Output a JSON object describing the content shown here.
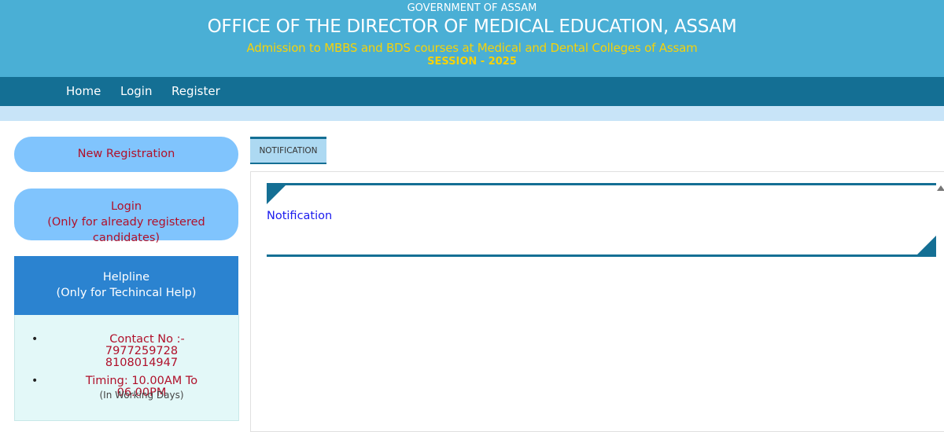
{
  "header": {
    "gov": "GOVERNMENT OF ASSAM",
    "office": "OFFICE OF THE DIRECTOR OF MEDICAL EDUCATION, ASSAM",
    "admission": "Admission to MBBS and BDS courses at Medical and Dental Colleges of Assam",
    "session": "SESSION - 2025"
  },
  "nav": {
    "home": "Home",
    "login": "Login",
    "register": "Register"
  },
  "sidebar": {
    "new_registration": "New Registration",
    "login_line1": "Login",
    "login_line2": "(Only for already registered candidates)",
    "helpline_title": "Helpline",
    "helpline_sub": "(Only for Techincal Help)",
    "contact_label": "Contact No :-",
    "phone1": "7977259728",
    "phone2": "8108014947",
    "timing": "Timing: 10.00AM To 06.00PM",
    "working_days": "(In Working Days)"
  },
  "main": {
    "tab_label": "NOTIFICATION",
    "notification_link": "Notification"
  },
  "colors": {
    "header_bg": "#4aafd5",
    "nav_bg": "#146f94",
    "accent_yellow": "#f5d20a",
    "pill_bg": "#80c4fd",
    "pill_text": "#b0102a",
    "helpline_bg": "#2b83d0"
  }
}
